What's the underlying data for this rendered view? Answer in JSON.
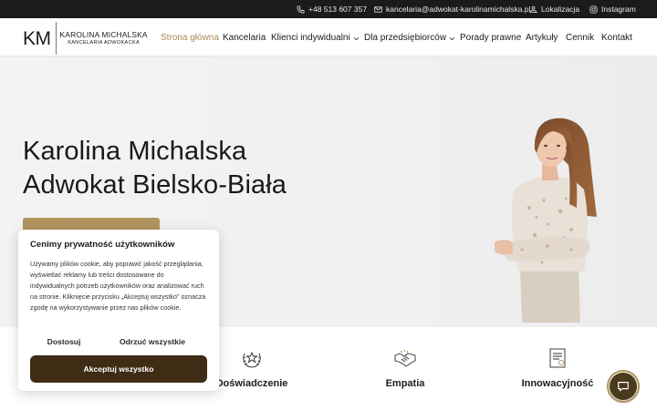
{
  "topbar": {
    "phone": "+48 513 607 357",
    "email": "kancelaria@adwokat-karolinamichalska.pl",
    "location": "Lokalizacja",
    "instagram": "Instagram"
  },
  "logo": {
    "mark": "KM",
    "name": "KAROLINA MICHALSKA",
    "subtitle": "KANCELARIA ADWOKACKA"
  },
  "nav": {
    "items": [
      {
        "label": "Strona główna",
        "active": true
      },
      {
        "label": "Kancelaria"
      },
      {
        "label": "Klienci indywidualni",
        "dropdown": true
      },
      {
        "label": "Dla przedsiębiorców",
        "dropdown": true
      },
      {
        "label": "Porady prawne"
      },
      {
        "label": "Artykuły"
      },
      {
        "label": "Cennik"
      },
      {
        "label": "Kontakt"
      }
    ]
  },
  "hero": {
    "title_line1": "Karolina Michalska",
    "title_line2": "Adwokat Bielsko-Biała"
  },
  "features": [
    {
      "label": "Doświadczenie",
      "icon": "laurel-star-icon"
    },
    {
      "label": "Empatia",
      "icon": "handshake-icon"
    },
    {
      "label": "Innowacyjność",
      "icon": "document-icon"
    }
  ],
  "cookie": {
    "title": "Cenimy prywatność użytkowników",
    "body": "Używamy plików cookie, aby poprawić jakość przeglądania, wyświetlać reklamy lub treści dostosowane do indywidualnych potrzeb użytkowników oraz analizować ruch na stronie. Kliknięcie przycisku „Akceptuj wszystko\" oznacza zgodę na wykorzystywanie przez nas plików cookie.",
    "customize": "Dostosuj",
    "reject": "Odrzuć wszystkie",
    "accept": "Akceptuj wszystko"
  },
  "colors": {
    "accent": "#b2945e",
    "dark": "#1b1b1b",
    "accept_bg": "#3f2c14"
  }
}
